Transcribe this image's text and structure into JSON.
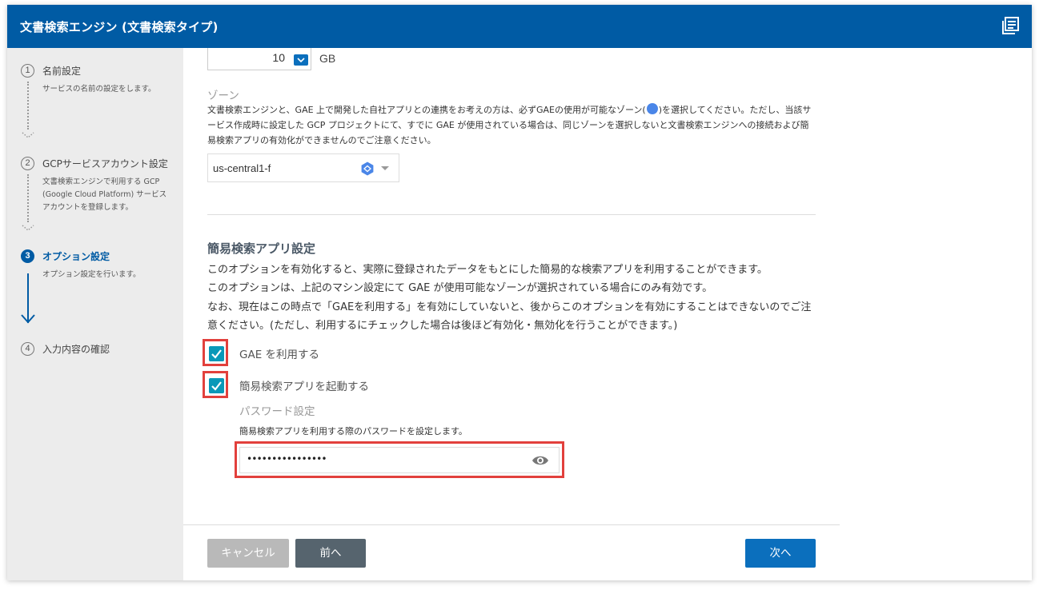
{
  "window": {
    "title": "文書検索エンジン (文書検索タイプ)",
    "icon": "document-list-icon"
  },
  "steps": [
    {
      "num": "1",
      "label": "名前設定",
      "desc": "サービスの名前の設定をします。"
    },
    {
      "num": "2",
      "label": "GCPサービスアカウント設定",
      "desc": "文書検索エンジンで利用する GCP (Google Cloud Platform) サービスアカウントを登録します。"
    },
    {
      "num": "3",
      "label": "オプション設定",
      "desc": "オプション設定を行います。",
      "active": true
    },
    {
      "num": "4",
      "label": "入力内容の確認",
      "desc": ""
    }
  ],
  "disk": {
    "value": "10",
    "unit": "GB"
  },
  "zone": {
    "label": "ゾーン",
    "desc_part1": "文書検索エンジンと、GAE 上で開発した自社アプリとの連携をお考えの方は、必ずGAEの使用が可能なゾーン(",
    "desc_part2": ")を選択してください。ただし、当該サービス作成時に設定した GCP プロジェクトにて、すでに GAE が使用されている場合は、同じゾーンを選択しないと文書検索エンジンへの接続および簡易検索アプリの有効化ができませんのでご注意ください。",
    "selected": "us-central1-f"
  },
  "app_section": {
    "title": "簡易検索アプリ設定",
    "desc_lines": [
      "このオプションを有効化すると、実際に登録されたデータをもとにした簡易的な検索アプリを利用することができます。",
      "このオプションは、上記のマシン設定にて GAE が使用可能なゾーンが選択されている場合にのみ有効です。",
      "なお、現在はこの時点で「GAEを利用する」を有効にしていないと、後からこのオプションを有効にすることはできないのでご注意ください。(ただし、利用するにチェックした場合は後ほど有効化・無効化を行うことができます。)"
    ],
    "use_gae": {
      "label": "GAE を利用する",
      "checked": true
    },
    "launch_app": {
      "label": "簡易検索アプリを起動する",
      "checked": true
    },
    "password": {
      "label": "パスワード設定",
      "desc": "簡易検索アプリを利用する際のパスワードを設定します。",
      "value": "••••••••••••••••"
    }
  },
  "buttons": {
    "cancel": "キャンセル",
    "prev": "前へ",
    "next": "次へ"
  },
  "colors": {
    "header": "#005ba4",
    "primary": "#0b6fbd",
    "check": "#0a98b8",
    "highlight": "#e2403c"
  }
}
